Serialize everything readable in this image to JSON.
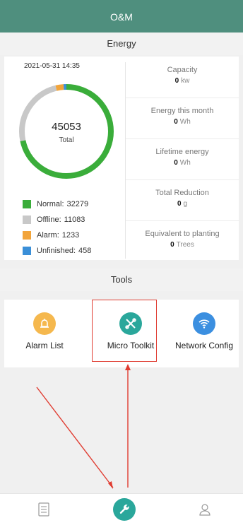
{
  "app": {
    "title": "O&M"
  },
  "energy": {
    "title": "Energy",
    "datetime": "2021-05-31 14:35",
    "total_value": "45053",
    "total_label": "Total",
    "legend": [
      {
        "label": "Normal:",
        "value": "32279",
        "color": "#3aad3a",
        "count": 32279
      },
      {
        "label": "Offline:",
        "value": "11083",
        "color": "#c8c8c8",
        "count": 11083
      },
      {
        "label": "Alarm:",
        "value": "1233",
        "color": "#f2a43a",
        "count": 1233
      },
      {
        "label": "Unfinished:",
        "value": "458",
        "color": "#3a8fd8",
        "count": 458
      }
    ],
    "stats": [
      {
        "label": "Capacity",
        "value": "0",
        "unit": "kw"
      },
      {
        "label": "Energy this month",
        "value": "0",
        "unit": "Wh"
      },
      {
        "label": "Lifetime energy",
        "value": "0",
        "unit": "Wh"
      },
      {
        "label": "Total Reduction",
        "value": "0",
        "unit": "g"
      },
      {
        "label": "Equivalent to planting",
        "value": "0",
        "unit": "Trees"
      }
    ]
  },
  "tools": {
    "title": "Tools",
    "items": [
      {
        "label": "Alarm List",
        "icon": "alarm-bell-icon",
        "color": "#f5b84e"
      },
      {
        "label": "Micro Toolkit",
        "icon": "tools-icon",
        "color": "#2aa79b"
      },
      {
        "label": "Network Config",
        "icon": "wifi-icon",
        "color": "#3b8fe0"
      }
    ]
  },
  "nav": {
    "items": [
      {
        "icon": "document-icon",
        "active": false
      },
      {
        "icon": "wrench-icon",
        "active": true
      },
      {
        "icon": "user-icon",
        "active": false
      }
    ]
  },
  "colors": {
    "header": "#4f8f7e",
    "annotation": "#e03c31",
    "active_nav": "#2aa79b"
  }
}
